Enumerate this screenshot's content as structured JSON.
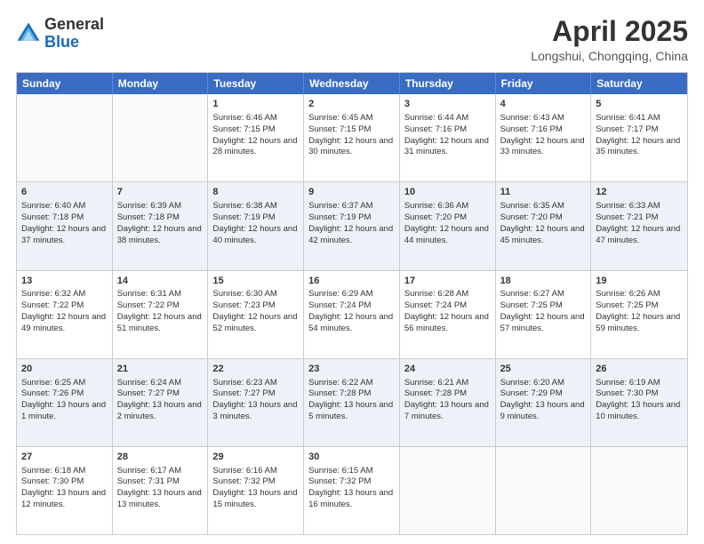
{
  "header": {
    "logo_general": "General",
    "logo_blue": "Blue",
    "month_title": "April 2025",
    "location": "Longshui, Chongqing, China"
  },
  "days_of_week": [
    "Sunday",
    "Monday",
    "Tuesday",
    "Wednesday",
    "Thursday",
    "Friday",
    "Saturday"
  ],
  "weeks": [
    [
      {
        "day": "",
        "info": ""
      },
      {
        "day": "",
        "info": ""
      },
      {
        "day": "1",
        "info": "Sunrise: 6:46 AM\nSunset: 7:15 PM\nDaylight: 12 hours and 28 minutes."
      },
      {
        "day": "2",
        "info": "Sunrise: 6:45 AM\nSunset: 7:15 PM\nDaylight: 12 hours and 30 minutes."
      },
      {
        "day": "3",
        "info": "Sunrise: 6:44 AM\nSunset: 7:16 PM\nDaylight: 12 hours and 31 minutes."
      },
      {
        "day": "4",
        "info": "Sunrise: 6:43 AM\nSunset: 7:16 PM\nDaylight: 12 hours and 33 minutes."
      },
      {
        "day": "5",
        "info": "Sunrise: 6:41 AM\nSunset: 7:17 PM\nDaylight: 12 hours and 35 minutes."
      }
    ],
    [
      {
        "day": "6",
        "info": "Sunrise: 6:40 AM\nSunset: 7:18 PM\nDaylight: 12 hours and 37 minutes."
      },
      {
        "day": "7",
        "info": "Sunrise: 6:39 AM\nSunset: 7:18 PM\nDaylight: 12 hours and 38 minutes."
      },
      {
        "day": "8",
        "info": "Sunrise: 6:38 AM\nSunset: 7:19 PM\nDaylight: 12 hours and 40 minutes."
      },
      {
        "day": "9",
        "info": "Sunrise: 6:37 AM\nSunset: 7:19 PM\nDaylight: 12 hours and 42 minutes."
      },
      {
        "day": "10",
        "info": "Sunrise: 6:36 AM\nSunset: 7:20 PM\nDaylight: 12 hours and 44 minutes."
      },
      {
        "day": "11",
        "info": "Sunrise: 6:35 AM\nSunset: 7:20 PM\nDaylight: 12 hours and 45 minutes."
      },
      {
        "day": "12",
        "info": "Sunrise: 6:33 AM\nSunset: 7:21 PM\nDaylight: 12 hours and 47 minutes."
      }
    ],
    [
      {
        "day": "13",
        "info": "Sunrise: 6:32 AM\nSunset: 7:22 PM\nDaylight: 12 hours and 49 minutes."
      },
      {
        "day": "14",
        "info": "Sunrise: 6:31 AM\nSunset: 7:22 PM\nDaylight: 12 hours and 51 minutes."
      },
      {
        "day": "15",
        "info": "Sunrise: 6:30 AM\nSunset: 7:23 PM\nDaylight: 12 hours and 52 minutes."
      },
      {
        "day": "16",
        "info": "Sunrise: 6:29 AM\nSunset: 7:24 PM\nDaylight: 12 hours and 54 minutes."
      },
      {
        "day": "17",
        "info": "Sunrise: 6:28 AM\nSunset: 7:24 PM\nDaylight: 12 hours and 56 minutes."
      },
      {
        "day": "18",
        "info": "Sunrise: 6:27 AM\nSunset: 7:25 PM\nDaylight: 12 hours and 57 minutes."
      },
      {
        "day": "19",
        "info": "Sunrise: 6:26 AM\nSunset: 7:25 PM\nDaylight: 12 hours and 59 minutes."
      }
    ],
    [
      {
        "day": "20",
        "info": "Sunrise: 6:25 AM\nSunset: 7:26 PM\nDaylight: 13 hours and 1 minute."
      },
      {
        "day": "21",
        "info": "Sunrise: 6:24 AM\nSunset: 7:27 PM\nDaylight: 13 hours and 2 minutes."
      },
      {
        "day": "22",
        "info": "Sunrise: 6:23 AM\nSunset: 7:27 PM\nDaylight: 13 hours and 3 minutes."
      },
      {
        "day": "23",
        "info": "Sunrise: 6:22 AM\nSunset: 7:28 PM\nDaylight: 13 hours and 5 minutes."
      },
      {
        "day": "24",
        "info": "Sunrise: 6:21 AM\nSunset: 7:28 PM\nDaylight: 13 hours and 7 minutes."
      },
      {
        "day": "25",
        "info": "Sunrise: 6:20 AM\nSunset: 7:29 PM\nDaylight: 13 hours and 9 minutes."
      },
      {
        "day": "26",
        "info": "Sunrise: 6:19 AM\nSunset: 7:30 PM\nDaylight: 13 hours and 10 minutes."
      }
    ],
    [
      {
        "day": "27",
        "info": "Sunrise: 6:18 AM\nSunset: 7:30 PM\nDaylight: 13 hours and 12 minutes."
      },
      {
        "day": "28",
        "info": "Sunrise: 6:17 AM\nSunset: 7:31 PM\nDaylight: 13 hours and 13 minutes."
      },
      {
        "day": "29",
        "info": "Sunrise: 6:16 AM\nSunset: 7:32 PM\nDaylight: 13 hours and 15 minutes."
      },
      {
        "day": "30",
        "info": "Sunrise: 6:15 AM\nSunset: 7:32 PM\nDaylight: 13 hours and 16 minutes."
      },
      {
        "day": "",
        "info": ""
      },
      {
        "day": "",
        "info": ""
      },
      {
        "day": "",
        "info": ""
      }
    ]
  ]
}
